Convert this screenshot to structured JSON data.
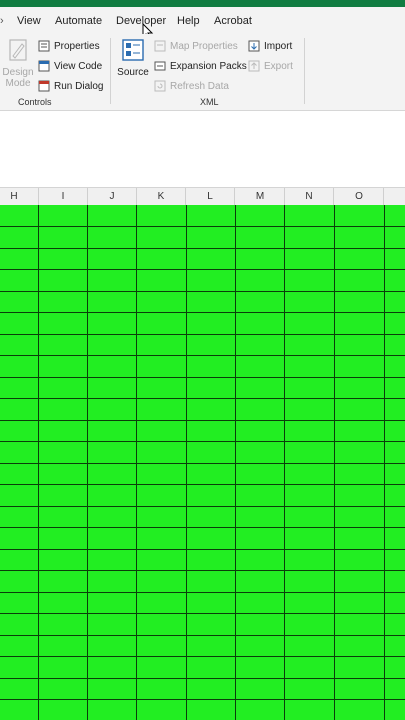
{
  "tabs": [
    {
      "label": "View",
      "active": false
    },
    {
      "label": "Automate",
      "active": false
    },
    {
      "label": "Developer",
      "active": true
    },
    {
      "label": "Help",
      "active": false
    },
    {
      "label": "Acrobat",
      "active": false
    }
  ],
  "ribbon": {
    "controls": {
      "design_mode_line1": "Design",
      "design_mode_line2": "Mode",
      "properties": "Properties",
      "view_code": "View Code",
      "run_dialog": "Run Dialog",
      "group_label": "Controls"
    },
    "xml": {
      "source": "Source",
      "map_properties": "Map Properties",
      "expansion_packs": "Expansion Packs",
      "refresh_data": "Refresh Data",
      "import": "Import",
      "export": "Export",
      "group_label": "XML"
    }
  },
  "columns": [
    "H",
    "I",
    "J",
    "K",
    "L",
    "M",
    "N",
    "O"
  ],
  "colors": {
    "accent": "#107c41",
    "cell_fill": "#22ee22",
    "gridline": "#0a3d0a"
  }
}
